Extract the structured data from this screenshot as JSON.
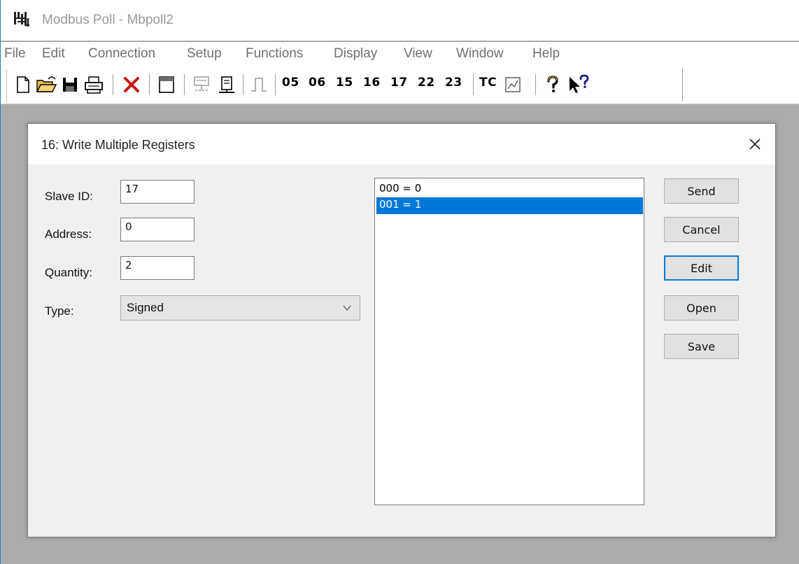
{
  "window": {
    "title": "Modbus Poll - Mbpoll2",
    "app_icon": "modbus-poll-icon"
  },
  "menu": [
    "File",
    "Edit",
    "Connection",
    "Setup",
    "Functions",
    "Display",
    "View",
    "Window",
    "Help"
  ],
  "toolbar": {
    "icons": [
      "new-document-icon",
      "open-folder-icon",
      "save-disk-icon",
      "print-icon",
      "delete-x-icon",
      "window-icon",
      "connect-icon",
      "disconnect-icon",
      "pulse-icon"
    ],
    "function_codes": [
      "05",
      "06",
      "15",
      "16",
      "17",
      "22",
      "23"
    ],
    "tc_label": "TC",
    "help_icons": [
      "help-icon",
      "context-help-icon"
    ]
  },
  "dialog": {
    "title": "16: Write Multiple Registers",
    "slave_id_label": "Slave ID:",
    "slave_id_value": "17",
    "address_label": "Address:",
    "address_value": "0",
    "quantity_label": "Quantity:",
    "quantity_value": "2",
    "type_label": "Type:",
    "type_value": "Signed",
    "registers": [
      {
        "text": "000 = 0",
        "selected": false
      },
      {
        "text": "001 = 1",
        "selected": true
      }
    ],
    "buttons": {
      "send": "Send",
      "cancel": "Cancel",
      "edit": "Edit",
      "open": "Open",
      "save": "Save"
    }
  },
  "colors": {
    "accent": "#0078d7",
    "window_border": "#1883d7",
    "workspace": "#ababab",
    "delete_icon": "#cc1111"
  }
}
